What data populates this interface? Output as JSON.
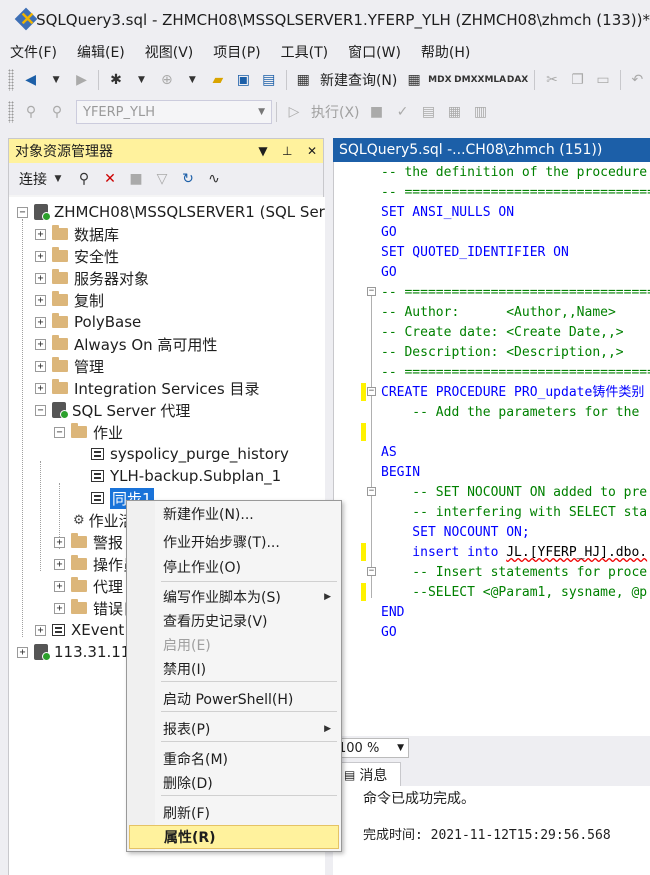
{
  "window": {
    "title": "SQLQuery3.sql - ZHMCH08\\MSSQLSERVER1.YFERP_YLH (ZHMCH08\\zhmch (133))*"
  },
  "menu": [
    "文件(F)",
    "编辑(E)",
    "视图(V)",
    "项目(P)",
    "工具(T)",
    "窗口(W)",
    "帮助(H)"
  ],
  "toolbar": {
    "new_query": "新建查询(N)",
    "mdx": "MDX",
    "dmx": "DMX",
    "xmla": "XMLA",
    "dax": "DAX",
    "database": "YFERP_YLH",
    "execute": "执行(X)"
  },
  "object_explorer": {
    "title": "对象资源管理器",
    "connect": "连接",
    "server": "ZHMCH08\\MSSQLSERVER1 (SQL Ser",
    "nodes": [
      "数据库",
      "安全性",
      "服务器对象",
      "复制",
      "PolyBase",
      "Always On 高可用性",
      "管理",
      "Integration Services 目录",
      "SQL Server 代理"
    ],
    "jobs_folder": "作业",
    "jobs": [
      "syspolicy_purge_history",
      "YLH-backup.Subplan_1",
      "同步1"
    ],
    "agent_children": [
      "作业活",
      "警报",
      "操作员",
      "代理",
      "错误日"
    ],
    "xevent": "XEvent",
    "other_server": "113.31.11"
  },
  "editor": {
    "tab": "SQLQuery5.sql -...CH08\\zhmch (151))",
    "lines": [
      {
        "t": "-- the definition of the procedure",
        "c": "cmt"
      },
      {
        "t": "-- ==================================",
        "c": "cmt"
      },
      {
        "t": "SET ANSI_NULLS ON",
        "c": "kw"
      },
      {
        "t": "GO",
        "c": "kw"
      },
      {
        "t": "SET QUOTED_IDENTIFIER ON",
        "c": "kw"
      },
      {
        "t": "GO",
        "c": "kw"
      },
      {
        "t": "-- ==================================",
        "c": "cmt"
      },
      {
        "t": "-- Author:      <Author,,Name>",
        "c": "cmt"
      },
      {
        "t": "-- Create date: <Create Date,,>",
        "c": "cmt"
      },
      {
        "t": "-- Description: <Description,,>",
        "c": "cmt"
      },
      {
        "t": "-- ==================================",
        "c": "cmt"
      },
      {
        "t": "CREATE PROCEDURE PRO_update铸件类别",
        "c": "kw"
      },
      {
        "t": "    -- Add the parameters for the",
        "c": "cmt"
      },
      {
        "t": "",
        "c": "plain"
      },
      {
        "t": "AS",
        "c": "kw"
      },
      {
        "t": "BEGIN",
        "c": "kw"
      },
      {
        "t": "    -- SET NOCOUNT ON added to pre",
        "c": "cmt"
      },
      {
        "t": "    -- interfering with SELECT sta",
        "c": "cmt"
      },
      {
        "t": "    SET NOCOUNT ON;",
        "c": "kw"
      },
      {
        "t": "    insert into JL.[YFERP_HJ].dbo.",
        "c": "ins"
      },
      {
        "t": "    -- Insert statements for proce",
        "c": "cmt"
      },
      {
        "t": "    --SELECT <@Param1, sysname, @p",
        "c": "cmt"
      },
      {
        "t": "END",
        "c": "kw"
      },
      {
        "t": "GO",
        "c": "kw"
      }
    ]
  },
  "zoom": "100 %",
  "results": {
    "tab": "消息",
    "message": "命令已成功完成。",
    "completion": "完成时间: 2021-11-12T15:29:56.568"
  },
  "context_menu": {
    "items": [
      {
        "label": "新建作业(N)...",
        "enabled": true
      },
      {
        "label": "作业开始步骤(T)...",
        "enabled": true
      },
      {
        "label": "停止作业(O)",
        "enabled": true
      },
      {
        "label": "编写作业脚本为(S)",
        "enabled": true,
        "submenu": true
      },
      {
        "label": "查看历史记录(V)",
        "enabled": true
      },
      {
        "label": "启用(E)",
        "enabled": false
      },
      {
        "label": "禁用(I)",
        "enabled": true
      },
      {
        "label": "启动 PowerShell(H)",
        "enabled": true
      },
      {
        "label": "报表(P)",
        "enabled": true,
        "submenu": true
      },
      {
        "label": "重命名(M)",
        "enabled": true
      },
      {
        "label": "删除(D)",
        "enabled": true
      },
      {
        "label": "刷新(F)",
        "enabled": true
      },
      {
        "label": "属性(R)",
        "enabled": true,
        "highlighted": true
      }
    ]
  },
  "colors": {
    "accent_tab": "#1c5fa8",
    "panel_header": "#fff29d",
    "selection": "#1a73d9"
  }
}
